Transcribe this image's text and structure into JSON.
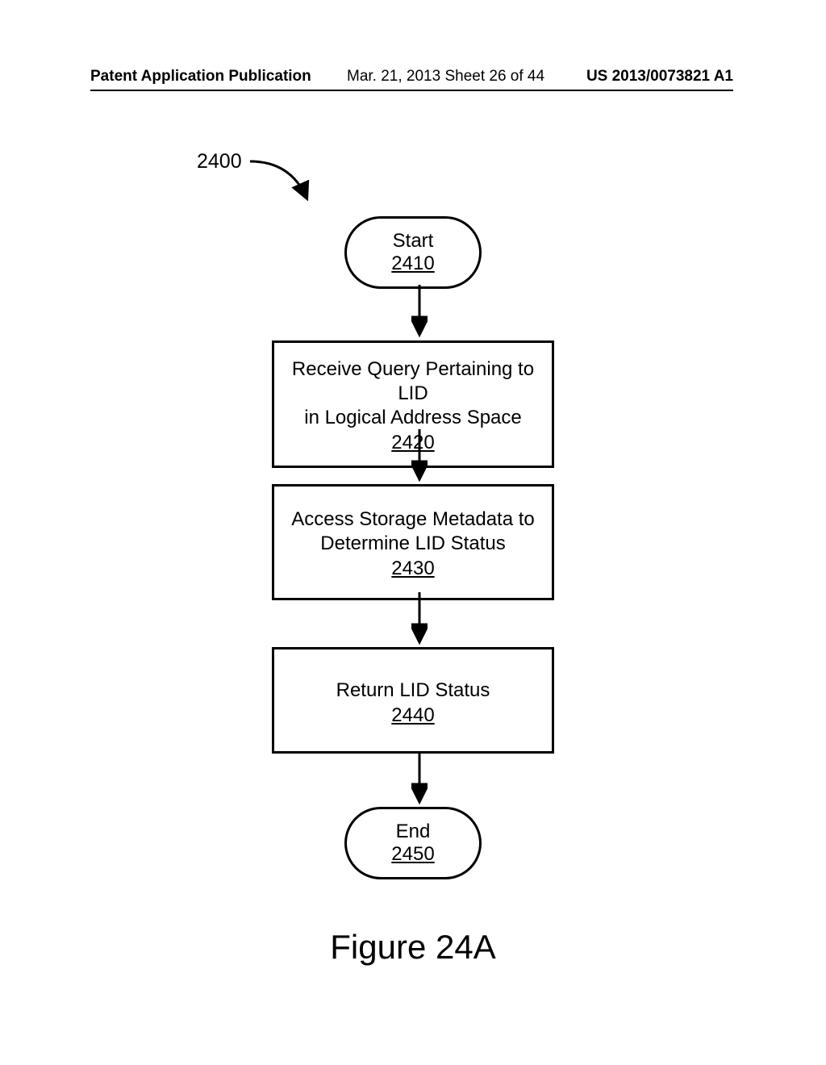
{
  "header": {
    "left": "Patent Application Publication",
    "mid": "Mar. 21, 2013  Sheet 26 of 44",
    "right": "US 2013/0073821 A1"
  },
  "callout": {
    "label": "2400"
  },
  "nodes": {
    "start": {
      "title": "Start",
      "num": "2410"
    },
    "receive": {
      "line1": "Receive Query Pertaining to LID",
      "line2": "in Logical Address Space",
      "num": "2420"
    },
    "access": {
      "line1": "Access Storage Metadata to",
      "line2": "Determine LID Status",
      "num": "2430"
    },
    "ret": {
      "line1": "Return LID Status",
      "line2": "",
      "num": "2440"
    },
    "end": {
      "title": "End",
      "num": "2450"
    }
  },
  "caption": "Figure 24A"
}
